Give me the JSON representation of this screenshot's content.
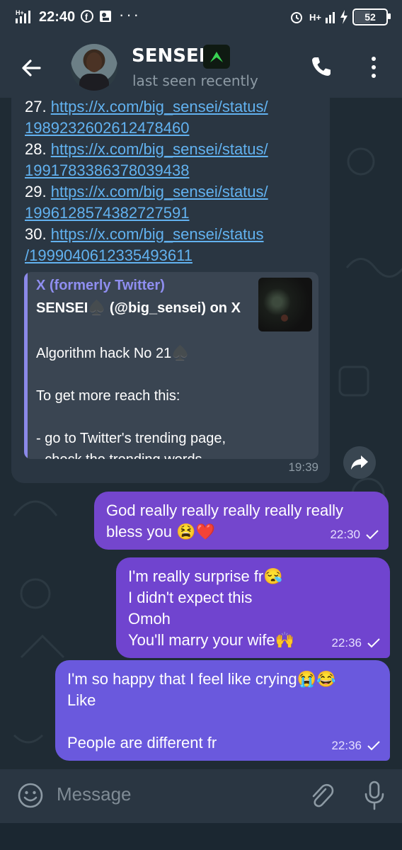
{
  "status_bar": {
    "time": "22:40",
    "network": "H+",
    "battery": "52",
    "more": "···"
  },
  "header": {
    "contact_name": "SENSEI",
    "last_seen": "last seen recently"
  },
  "incoming_message": {
    "links": [
      {
        "num": "27.",
        "parts": [
          "https://x.com/big_sensei/status/",
          "1989232602612478460"
        ]
      },
      {
        "num": "28.",
        "parts": [
          "https://x.com/big_sensei/status/",
          "1991783386378039438"
        ]
      },
      {
        "num": "29.",
        "parts": [
          "https://x.com/big_sensei/status/",
          "1996128574382727591"
        ]
      },
      {
        "num": "30.",
        "parts": [
          "https://x.com/big_sensei/status",
          "/1999040612335493611"
        ]
      }
    ],
    "preview": {
      "site": "X (formerly Twitter)",
      "title": "SENSEI♠️ (@big_sensei) on X",
      "description": "Algorithm hack No 21♠️\n\nTo get more reach this:\n\n- go to Twitter's trending page,\n- check the trending words.…"
    },
    "time": "19:39"
  },
  "outgoing_messages": [
    {
      "text": "God really really really really really\nbless you 😫❤️",
      "time": "22:30"
    },
    {
      "text": "I'm really surprise fr😪\nI didn't expect this\nOmoh\nYou'll marry your wife🙌",
      "time": "22:36"
    },
    {
      "text": "I'm so happy that I feel like crying😭😂\nLike\n\nPeople are different fr",
      "time": "22:36"
    }
  ],
  "input": {
    "placeholder": "Message"
  },
  "colors": {
    "accent_purple": "#7446cd",
    "link_blue": "#62b2f0",
    "preview_site": "#8f8ef0"
  },
  "icons": [
    "back-arrow-icon",
    "phone-icon",
    "more-vertical-icon",
    "share-icon",
    "emoji-icon",
    "attach-icon",
    "mic-icon",
    "checkmark-icon"
  ]
}
